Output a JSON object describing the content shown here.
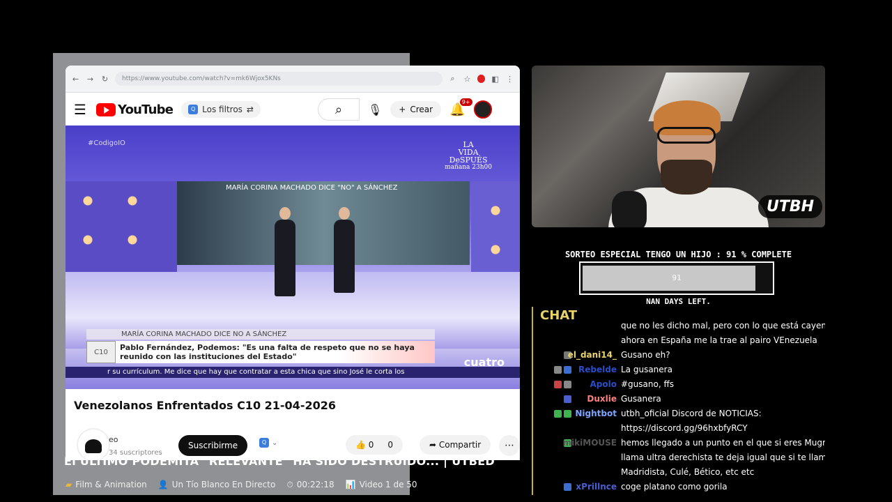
{
  "browser": {
    "url": "https://www.youtube.com/watch?v=mk6Wjox5KNs",
    "youtube": {
      "logo_text": "YouTube",
      "filters_label": "Los filtros",
      "create_label": "Crear",
      "notifications_badge": "9+"
    }
  },
  "video_frame": {
    "tag": "#CodigoIO",
    "promo_line1": "LA",
    "promo_line2": "VIDA",
    "promo_line3": "DeSPUÉS",
    "promo_line4": "mañana 23h00",
    "screen_title": "MARÍA CORINA MACHADO DICE \"NO\" A SÁNCHEZ",
    "lower_third_top": "MARÍA CORINA MACHADO DICE NO A SÁNCHEZ",
    "lower_third_logo": "C10",
    "lower_third_text": "Pablo Fernández, Podemos: \"Es una falta de respeto que no se haya reunido con las instituciones del Estado\"",
    "ticker": "r su currículum. Me dice que hay que contratar a esta chica que sino José le corta los",
    "channel_logo": "cuatro"
  },
  "video_info": {
    "title": "Venezolanos Enfrentados C10 21-04-2026",
    "channel_name": "eo",
    "subscribers": "34 suscriptores",
    "subscribe_label": "Suscribirme",
    "likes": "0",
    "dislikes": "0",
    "share_label": "Compartir"
  },
  "stream": {
    "webcam_logo": "UTBH",
    "goal_text": "SORTEO ESPECIAL TENGO UN HIJO : 91 % COMPLETE",
    "goal_percent": 91,
    "goal_value": "91",
    "goal_days": "NAN DAYS LEFT.",
    "chat_title": "CHAT",
    "chat": [
      {
        "user": "",
        "color": "#ffffff",
        "text": "que no les dicho mal, pero con lo que está cayendo",
        "badges": []
      },
      {
        "user": "",
        "color": "#ffffff",
        "text": "ahora en España me la trae al pairo VEnezuela",
        "badges": []
      },
      {
        "user": "el_dani14_",
        "color": "#e8d36a",
        "text": "Gusano eh?",
        "badges": [
          "#777777"
        ]
      },
      {
        "user": "Rebelde",
        "color": "#2a4dc9",
        "text": "La gusanera",
        "badges": [
          "#888888",
          "#3a6ed0"
        ]
      },
      {
        "user": "Apolo",
        "color": "#2a4dc9",
        "text": "#gusano, ffs",
        "badges": [
          "#c94444",
          "#888888"
        ]
      },
      {
        "user": "Duxlie",
        "color": "#ff7f7f",
        "text": "Gusanera",
        "badges": [
          "#4a5fd0"
        ]
      },
      {
        "user": "Nightbot",
        "color": "#7aa5ff",
        "text": "utbh_oficial Discord de NOTICIAS:",
        "badges": [
          "#3fb34f",
          "#3fb34f"
        ]
      },
      {
        "user": "",
        "color": "#ffffff",
        "text": "https://discord.gg/96hxbfyRCY",
        "badges": []
      },
      {
        "user": "mikiMOUSE",
        "color": "#555555",
        "text": "hemos llegado a un punto en el que si eres Mugre",
        "badges": [
          "#3fb34f"
        ]
      },
      {
        "user": "",
        "color": "#ffffff",
        "text": "llama ultra derechista te deja igual que si te llaman",
        "badges": []
      },
      {
        "user": "",
        "color": "#ffffff",
        "text": "Madridista, Culé, Bético, etc etc",
        "badges": []
      },
      {
        "user": "xPrillnce",
        "color": "#4a5fd0",
        "text": "coge platano como gorila",
        "badges": [
          "#3a6ed0"
        ]
      }
    ]
  },
  "caption": {
    "title": "El ÚLTIMO PODEMITA \"RELEVANTE\" HA SIDO DESTRUIDO... | UTBED",
    "category": "Film & Animation",
    "channel": "Un Tío Blanco En Directo",
    "duration": "00:22:18",
    "playlist_pos": "Video 1 de 50"
  }
}
